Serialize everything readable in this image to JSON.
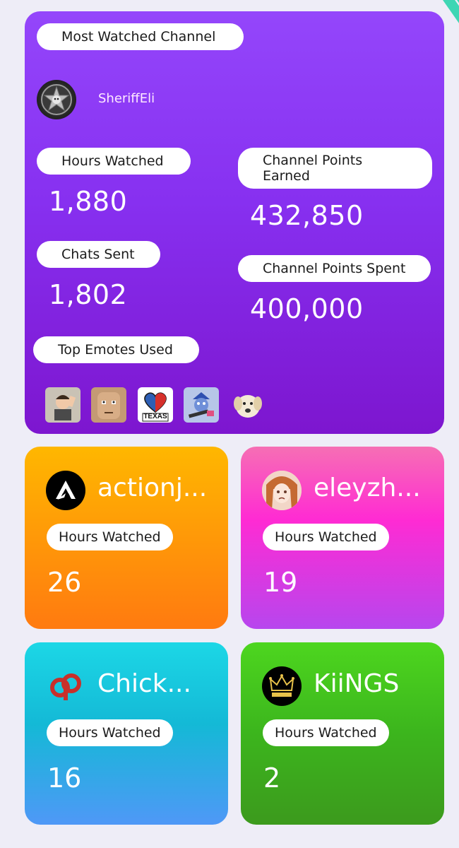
{
  "main": {
    "section_label": "Most Watched Channel",
    "channel_name": "SheriffEli",
    "stats": {
      "hours_label": "Hours Watched",
      "hours_value": "1,880",
      "chats_label": "Chats Sent",
      "chats_value": "1,802",
      "points_earned_label": "Channel Points Earned",
      "points_earned_value": "432,850",
      "points_spent_label": "Channel Points Spent",
      "points_spent_value": "400,000"
    },
    "emotes_label": "Top Emotes Used",
    "emotes": [
      {
        "name": "salute-avatar-emote",
        "bg": "#c9c2b5"
      },
      {
        "name": "stern-face-emote",
        "bg": "#c49a74"
      },
      {
        "name": "texas-heart-emote",
        "bg": "#ffffff",
        "text": "TEXAS"
      },
      {
        "name": "police-dog-emote",
        "bg": "#b7c6e8"
      },
      {
        "name": "dog-face-emote",
        "bg": "#f3e6cf"
      }
    ]
  },
  "cards": [
    {
      "name": "actionj...",
      "label": "Hours Watched",
      "value": "26",
      "gradient": [
        "#ffb700",
        "#ff7a10"
      ],
      "avatar_bg": "#000000",
      "icon": "action-logo-icon"
    },
    {
      "name": "eleyzh...",
      "label": "Hours Watched",
      "value": "19",
      "gradient": [
        "#f66fb4",
        "#b746ee"
      ],
      "avatar_bg": "#f2d6c7",
      "icon": "anime-girl-icon"
    },
    {
      "name": "Chick...",
      "label": "Hours Watched",
      "value": "16",
      "gradient": [
        "#1cd7e6",
        "#4f98f7"
      ],
      "avatar_bg": "#ffffff",
      "icon": "cp-logo-icon"
    },
    {
      "name": "KiiNGS",
      "label": "Hours Watched",
      "value": "2",
      "gradient": [
        "#4dd61f",
        "#3c9a1d"
      ],
      "avatar_bg": "#000000",
      "icon": "crown-icon"
    }
  ],
  "colors": {
    "main_card_top": "#9446fb",
    "main_card_bottom": "#7d16cf",
    "page_bg": "#eeedf7"
  }
}
